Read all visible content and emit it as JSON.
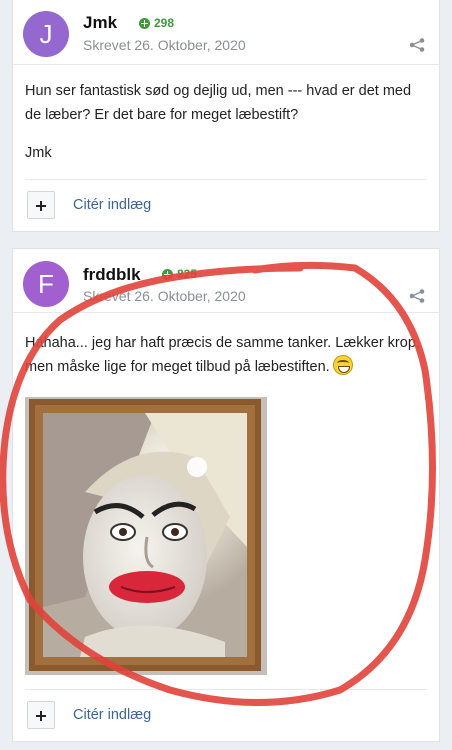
{
  "posts": [
    {
      "avatar_letter": "J",
      "author": "Jmk",
      "reputation": "298",
      "date": "Skrevet 26. Oktober, 2020",
      "body": [
        "Hun ser fantastisk sød og dejlig ud, men --- hvad er det med de læber? Er det bare for meget læbestift?",
        "Jmk"
      ],
      "quote_label": "Citér indlæg"
    },
    {
      "avatar_letter": "F",
      "author": "frddblk",
      "reputation": "825",
      "date": "Skrevet 26. Oktober, 2020",
      "body": [
        "Hahaha...  jeg har haft præcis de samme tanker. Lækker krop, men måske lige for meget tilbud på læbestiften."
      ],
      "quote_label": "Citér indlæg"
    }
  ],
  "icons": {
    "share": "share-icon",
    "reputation": "plus-circle-icon",
    "emoji": "grinning-face-icon",
    "multiquote": "plus-icon"
  },
  "colors": {
    "avatar_1": "#9468cf",
    "avatar_2": "#a15fcf",
    "reputation": "#3e9a3b",
    "link": "#3d6594",
    "annotation": "#e0423a"
  }
}
